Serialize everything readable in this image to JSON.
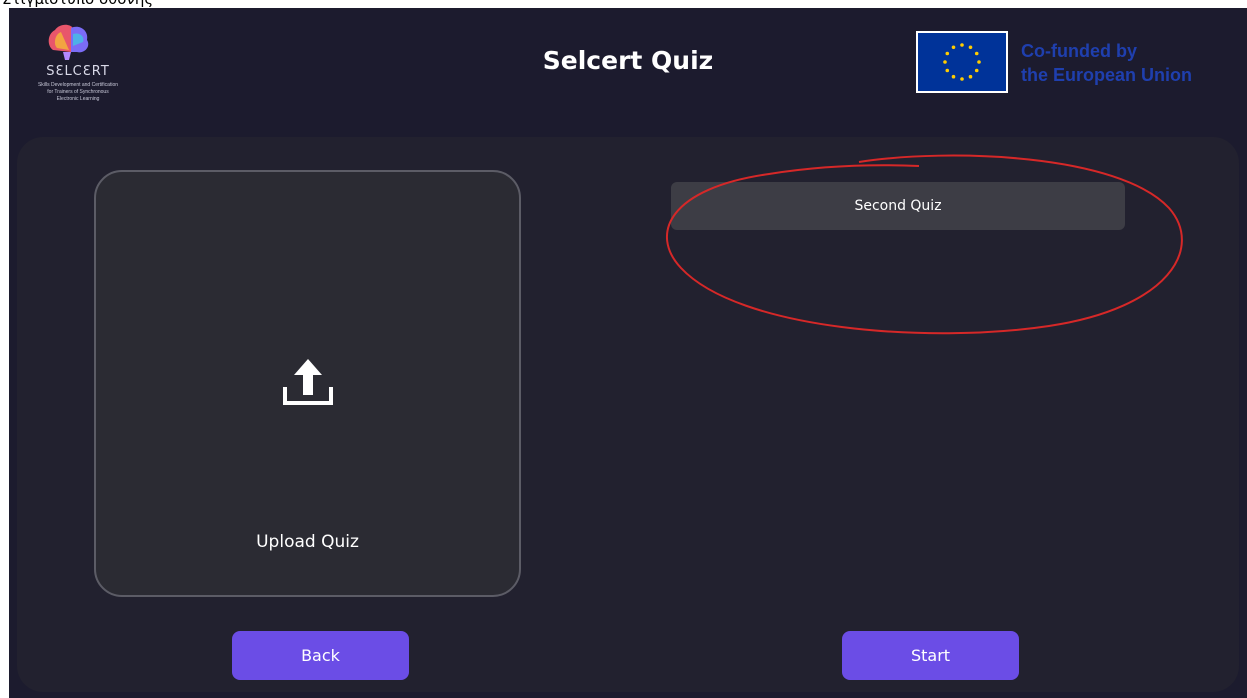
{
  "caption": "Στιγμιότυπο οθόνης",
  "header": {
    "title": "Selcert Quiz",
    "logo": {
      "word": "SƐLCƐRT",
      "tagline": [
        "Skills Development and Certification",
        "for Trainers of Synchronous",
        "Electronic Learning"
      ]
    },
    "funding": {
      "line1": "Co-funded by",
      "line2": "the European Union",
      "flag_color": "#003399",
      "text_color": "#1f3fae"
    }
  },
  "upload": {
    "label": "Upload Quiz",
    "icon": "upload-icon"
  },
  "quizzes": [
    {
      "label": "Second Quiz"
    }
  ],
  "annotation": {
    "shape": "hand-drawn ellipse",
    "color": "#d62828",
    "target": "Second Quiz"
  },
  "buttons": {
    "back_label": "Back",
    "start_label": "Start"
  },
  "colors": {
    "background": "#1c1b2e",
    "panel": "#22212f",
    "card": "#2b2b33",
    "list_item": "#3d3d45",
    "accent": "#6b4de6"
  }
}
